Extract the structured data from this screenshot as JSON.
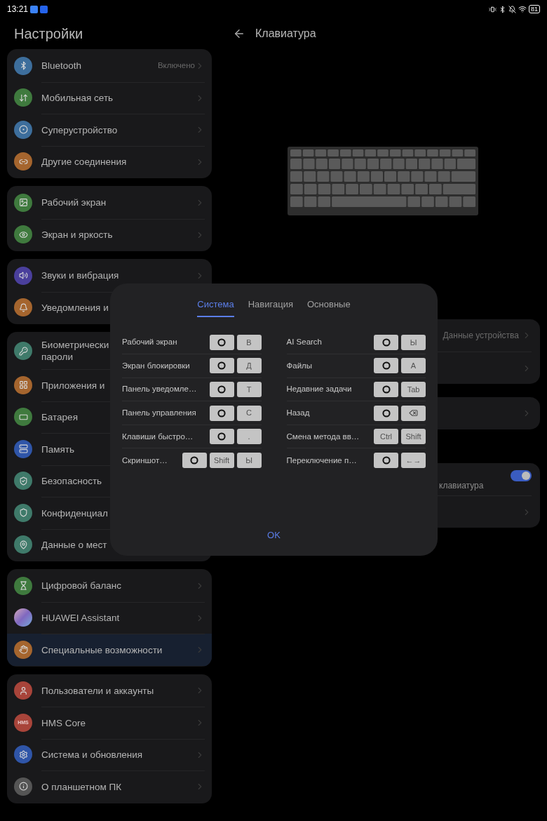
{
  "status_bar": {
    "time": "13:21",
    "battery": "81"
  },
  "sidebar": {
    "title": "Настройки",
    "groups": [
      {
        "items": [
          {
            "label": "Bluetooth",
            "value": "Включено",
            "color": "#3d6e9c",
            "selected": false
          },
          {
            "label": "Мобильная сеть",
            "color": "#3f7a3e",
            "selected": false
          },
          {
            "label": "Суперустройство",
            "color": "#3d6e9c",
            "selected": false
          },
          {
            "label": "Другие соединения",
            "color": "#a5652e",
            "selected": false
          }
        ]
      },
      {
        "items": [
          {
            "label": "Рабочий экран",
            "color": "#3f7a3e",
            "selected": false
          },
          {
            "label": "Экран и яркость",
            "color": "#3f7a3e",
            "selected": false
          }
        ]
      },
      {
        "items": [
          {
            "label": "Звуки и вибрация",
            "color": "#4a3f9c",
            "selected": false
          },
          {
            "label": "Уведомления и",
            "color": "#a5652e",
            "selected": false
          }
        ]
      },
      {
        "items": [
          {
            "label": "Биометрически",
            "sublabel": "пароли",
            "color": "#3f7a6a",
            "selected": false
          },
          {
            "label": "Приложения и",
            "color": "#a5652e",
            "selected": false
          },
          {
            "label": "Батарея",
            "color": "#3f7a3e",
            "selected": false
          },
          {
            "label": "Память",
            "color": "#2f55a8",
            "selected": false
          },
          {
            "label": "Безопасность",
            "color": "#3f7a6a",
            "selected": false
          },
          {
            "label": "Конфиденциал",
            "color": "#3f7a6a",
            "selected": false
          },
          {
            "label": "Данные о мест",
            "color": "#3f7a6a",
            "selected": false
          }
        ]
      },
      {
        "items": [
          {
            "label": "Цифровой баланс",
            "color": "#3f7a3e",
            "selected": false
          },
          {
            "label": "HUAWEI Assistant",
            "selected": false
          },
          {
            "label": "Специальные возможности",
            "color": "#a5652e",
            "selected": true
          }
        ]
      },
      {
        "items": [
          {
            "label": "Пользователи и аккаунты",
            "color": "#a8443a",
            "selected": false
          },
          {
            "label": "HMS Core",
            "color": "#a8443a",
            "icon_text": "HMS",
            "selected": false
          },
          {
            "label": "Система и обновления",
            "color": "#2f55a8",
            "selected": false
          },
          {
            "label": "О планшетном ПК",
            "color": "#555555",
            "selected": false
          }
        ]
      }
    ]
  },
  "detail": {
    "title": "Клавиатура",
    "cards": [
      {
        "rows": [
          {
            "kind": "value",
            "value": "Данные устройства"
          },
          {
            "kind": "chevron"
          }
        ]
      },
      {
        "rows": [
          {
            "kind": "chevron"
          }
        ]
      },
      {
        "rows": [
          {
            "kind": "switch",
            "label": "клавиатура",
            "on": true
          },
          {
            "kind": "chevron"
          }
        ]
      }
    ]
  },
  "dialog": {
    "tabs": [
      {
        "label": "Система",
        "selected": true
      },
      {
        "label": "Навигация",
        "selected": false
      },
      {
        "label": "Основные",
        "selected": false
      }
    ],
    "columns": [
      [
        {
          "label": "Рабочий экран",
          "keys": [
            {
              "kind": "ring"
            },
            {
              "kind": "text",
              "label": "В"
            }
          ]
        },
        {
          "label": "Экран блокировки",
          "keys": [
            {
              "kind": "ring"
            },
            {
              "kind": "text",
              "label": "Д"
            }
          ]
        },
        {
          "label": "Панель уведомле…",
          "keys": [
            {
              "kind": "ring"
            },
            {
              "kind": "text",
              "label": "Т"
            }
          ]
        },
        {
          "label": "Панель управления",
          "keys": [
            {
              "kind": "ring"
            },
            {
              "kind": "text",
              "label": "С"
            }
          ]
        },
        {
          "label": "Клавиши быстро…",
          "keys": [
            {
              "kind": "ring"
            },
            {
              "kind": "text",
              "label": "."
            }
          ]
        },
        {
          "label": "Скриншот…",
          "keys": [
            {
              "kind": "ring"
            },
            {
              "kind": "text",
              "label": "Shift"
            },
            {
              "kind": "text",
              "label": "Ы"
            }
          ]
        }
      ],
      [
        {
          "label": "AI Search",
          "keys": [
            {
              "kind": "ring"
            },
            {
              "kind": "text",
              "label": "Ы"
            }
          ]
        },
        {
          "label": "Файлы",
          "keys": [
            {
              "kind": "ring"
            },
            {
              "kind": "text",
              "label": "А"
            }
          ]
        },
        {
          "label": "Недавние задачи",
          "keys": [
            {
              "kind": "ring"
            },
            {
              "kind": "text",
              "label": "Tab"
            }
          ]
        },
        {
          "label": "Назад",
          "keys": [
            {
              "kind": "ring"
            },
            {
              "kind": "backspace"
            }
          ]
        },
        {
          "label": "Смена метода вв…",
          "keys": [
            {
              "kind": "text",
              "label": "Ctrl"
            },
            {
              "kind": "text",
              "label": "Shift"
            }
          ]
        },
        {
          "label": "Переключение п…",
          "keys": [
            {
              "kind": "ring"
            },
            {
              "kind": "text",
              "label": "←→"
            }
          ]
        }
      ]
    ],
    "ok": "OK"
  }
}
